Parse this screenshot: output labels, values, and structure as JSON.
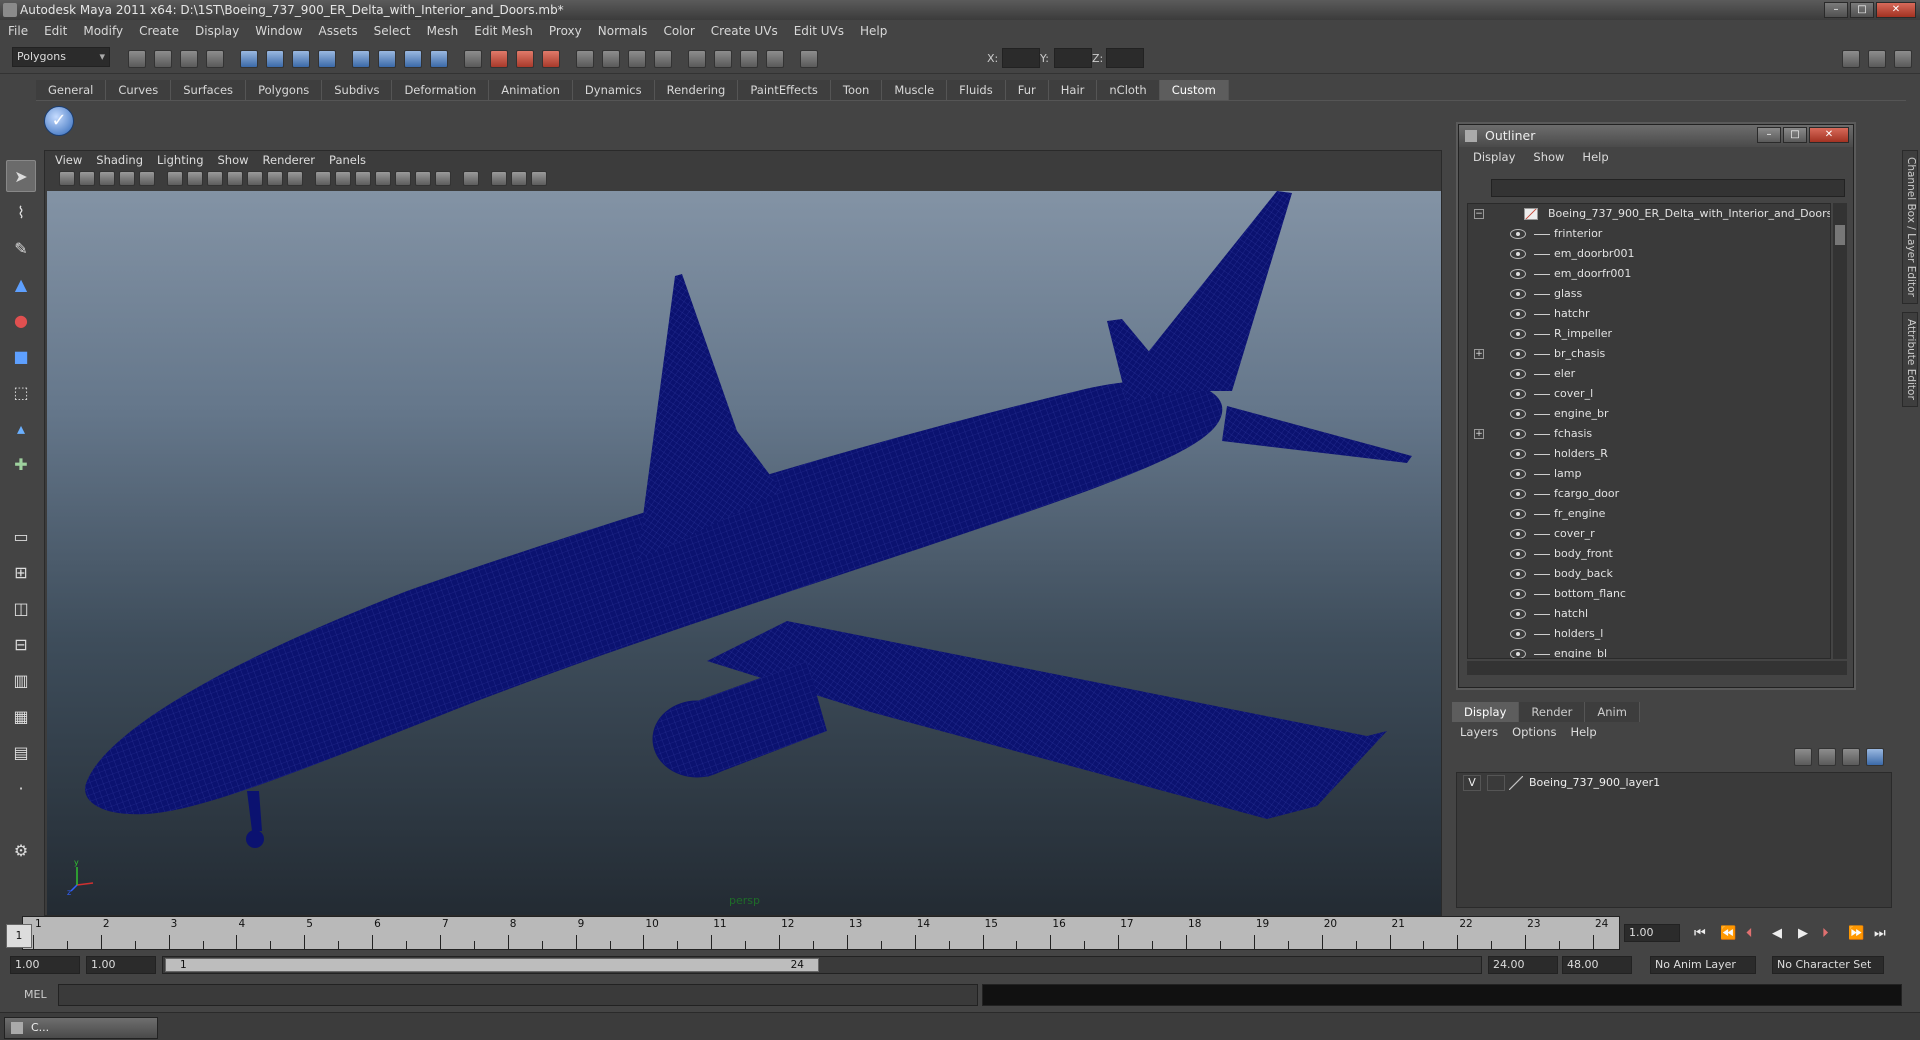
{
  "app": {
    "title": "Autodesk Maya 2011 x64: D:\\1ST\\Boeing_737_900_ER_Delta_with_Interior_and_Doors.mb*",
    "menus": [
      "File",
      "Edit",
      "Modify",
      "Create",
      "Display",
      "Window",
      "Assets",
      "Select",
      "Mesh",
      "Edit Mesh",
      "Proxy",
      "Normals",
      "Color",
      "Create UVs",
      "Edit UVs",
      "Help"
    ],
    "mode": "Polygons",
    "coords": {
      "x": "X:",
      "y": "Y:",
      "z": "Z:"
    }
  },
  "shelf": {
    "tabs": [
      "General",
      "Curves",
      "Surfaces",
      "Polygons",
      "Subdivs",
      "Deformation",
      "Animation",
      "Dynamics",
      "Rendering",
      "PaintEffects",
      "Toon",
      "Muscle",
      "Fluids",
      "Fur",
      "Hair",
      "nCloth",
      "Custom"
    ],
    "active_tab": "Custom"
  },
  "viewport": {
    "menus": [
      "View",
      "Shading",
      "Lighting",
      "Show",
      "Renderer",
      "Panels"
    ],
    "camera": "persp",
    "wire_color": "#0b1270"
  },
  "outliner": {
    "title": "Outliner",
    "menus": [
      "Display",
      "Show",
      "Help"
    ],
    "root": "Boeing_737_900_ER_Delta_with_Interior_and_Doors",
    "items": [
      {
        "name": "frinterior",
        "expandable": false
      },
      {
        "name": "em_doorbr001",
        "expandable": false
      },
      {
        "name": "em_doorfr001",
        "expandable": false
      },
      {
        "name": "glass",
        "expandable": false
      },
      {
        "name": "hatchr",
        "expandable": false
      },
      {
        "name": "R_impeller",
        "expandable": false
      },
      {
        "name": "br_chasis",
        "expandable": true
      },
      {
        "name": "eler",
        "expandable": false
      },
      {
        "name": "cover_l",
        "expandable": false
      },
      {
        "name": "engine_br",
        "expandable": false
      },
      {
        "name": "fchasis",
        "expandable": true
      },
      {
        "name": "holders_R",
        "expandable": false
      },
      {
        "name": "lamp",
        "expandable": false
      },
      {
        "name": "fcargo_door",
        "expandable": false
      },
      {
        "name": "fr_engine",
        "expandable": false
      },
      {
        "name": "cover_r",
        "expandable": false
      },
      {
        "name": "body_front",
        "expandable": false
      },
      {
        "name": "body_back",
        "expandable": false
      },
      {
        "name": "bottom_flanc",
        "expandable": false
      },
      {
        "name": "hatchl",
        "expandable": false
      },
      {
        "name": "holders_l",
        "expandable": false
      },
      {
        "name": "engine_bl",
        "expandable": false
      }
    ]
  },
  "sidetabs": [
    "Channel Box / Layer Editor",
    "Attribute Editor"
  ],
  "layers": {
    "tabs": [
      "Display",
      "Render",
      "Anim"
    ],
    "active_tab": "Display",
    "menus": [
      "Layers",
      "Options",
      "Help"
    ],
    "rows": [
      {
        "visible": "V",
        "name": "Boeing_737_900_layer1"
      }
    ]
  },
  "timeline": {
    "ticks": [
      "1",
      "2",
      "3",
      "4",
      "5",
      "6",
      "7",
      "8",
      "9",
      "10",
      "11",
      "12",
      "13",
      "14",
      "15",
      "16",
      "17",
      "18",
      "19",
      "20",
      "21",
      "22",
      "23",
      "24"
    ],
    "current_marker": "1",
    "current_frame": "1.00"
  },
  "range": {
    "start": "1.00",
    "playback_start": "1.00",
    "bar_start": "1",
    "bar_end": "24",
    "playback_end": "24.00",
    "end": "48.00",
    "anim_layer": "No Anim Layer",
    "character_set": "No Character Set"
  },
  "cmdline": {
    "label": "MEL"
  },
  "taskbar": {
    "label": "C..."
  }
}
